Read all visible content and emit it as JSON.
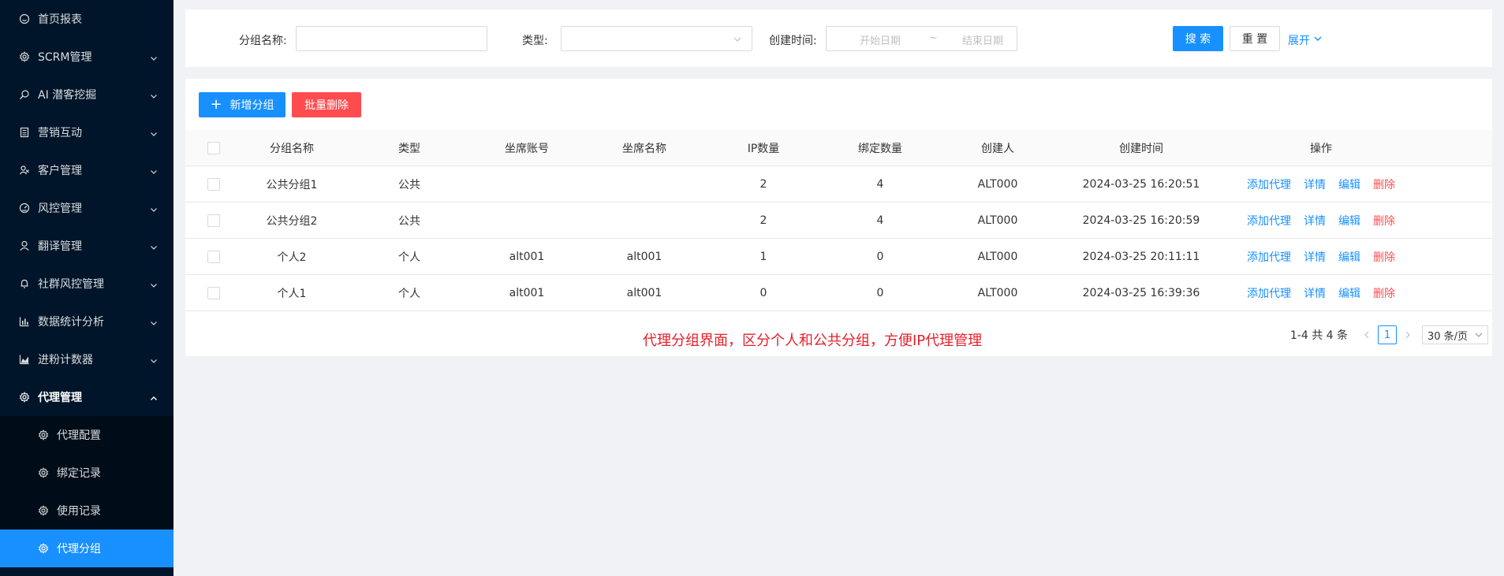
{
  "sidebar": {
    "items": [
      {
        "label": "首页报表",
        "icon": "smile-icon",
        "has_arrow": false
      },
      {
        "label": "SCRM管理",
        "icon": "gear-icon",
        "has_arrow": true
      },
      {
        "label": "AI 潜客挖掘",
        "icon": "search-icon",
        "has_arrow": true
      },
      {
        "label": "营销互动",
        "icon": "calculator-icon",
        "has_arrow": true
      },
      {
        "label": "客户管理",
        "icon": "users-icon",
        "has_arrow": true
      },
      {
        "label": "风控管理",
        "icon": "dashboard-icon",
        "has_arrow": true
      },
      {
        "label": "翻译管理",
        "icon": "user-icon",
        "has_arrow": true
      },
      {
        "label": "社群风控管理",
        "icon": "bell-icon",
        "has_arrow": true
      },
      {
        "label": "数据统计分析",
        "icon": "bar-chart-icon",
        "has_arrow": true
      },
      {
        "label": "进粉计数器",
        "icon": "area-chart-icon",
        "has_arrow": true
      }
    ],
    "open_item": {
      "label": "代理管理",
      "icon": "gear-icon"
    },
    "sub_items": [
      {
        "label": "代理配置",
        "active": false
      },
      {
        "label": "绑定记录",
        "active": false
      },
      {
        "label": "使用记录",
        "active": false
      },
      {
        "label": "代理分组",
        "active": true
      }
    ]
  },
  "filter": {
    "group_name_label": "分组名称:",
    "group_name_value": "",
    "type_label": "类型:",
    "type_value": "",
    "created_label": "创建时间:",
    "start_placeholder": "开始日期",
    "range_separator": "~",
    "end_placeholder": "结束日期",
    "search_label": "搜 索",
    "reset_label": "重 置",
    "expand_label": "展开"
  },
  "toolbar": {
    "add_label": "新增分组",
    "batch_delete_label": "批量删除"
  },
  "table": {
    "headers": [
      "分组名称",
      "类型",
      "坐席账号",
      "坐席名称",
      "IP数量",
      "绑定数量",
      "创建人",
      "创建时间",
      "操作"
    ],
    "rows": [
      {
        "name": "公共分组1",
        "type": "公共",
        "seat_account": "",
        "seat_name": "",
        "ip_count": "2",
        "bind_count": "4",
        "creator": "ALT000",
        "created_at": "2024-03-25 16:20:51"
      },
      {
        "name": "公共分组2",
        "type": "公共",
        "seat_account": "",
        "seat_name": "",
        "ip_count": "2",
        "bind_count": "4",
        "creator": "ALT000",
        "created_at": "2024-03-25 16:20:59"
      },
      {
        "name": "个人2",
        "type": "个人",
        "seat_account": "alt001",
        "seat_name": "alt001",
        "ip_count": "1",
        "bind_count": "0",
        "creator": "ALT000",
        "created_at": "2024-03-25 20:11:11"
      },
      {
        "name": "个人1",
        "type": "个人",
        "seat_account": "alt001",
        "seat_name": "alt001",
        "ip_count": "0",
        "bind_count": "0",
        "creator": "ALT000",
        "created_at": "2024-03-25 16:39:36"
      }
    ],
    "actions": {
      "add_proxy": "添加代理",
      "details": "详情",
      "edit": "编辑",
      "delete": "删除"
    }
  },
  "note": "代理分组界面，区分个人和公共分组，方便IP代理管理",
  "pagination": {
    "total_text": "1-4 共 4 条",
    "current_page": "1",
    "page_size": "30 条/页"
  },
  "colors": {
    "sidebar_bg": "#001529",
    "submenu_bg": "#000c17",
    "primary": "#1890ff",
    "danger": "#ff4d4f",
    "note_red": "#e4202b"
  }
}
